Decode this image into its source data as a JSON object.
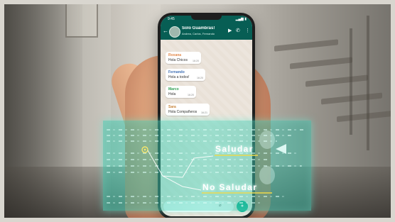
{
  "phone": {
    "status_time": "9:45",
    "chat_title": "Solo Guambras!",
    "chat_members": "Andrea, Carlos, Fernando",
    "messages": [
      {
        "sender": "Roxana",
        "text": "Hola Chicos",
        "time": "16:20"
      },
      {
        "sender": "Fernando",
        "text": "Hola a todos!",
        "time": "16:20"
      },
      {
        "sender": "Marco",
        "text": "Hola",
        "time": "16:20"
      },
      {
        "sender": "Sara",
        "text": "Hola Compañeros",
        "time": "16:21"
      }
    ]
  },
  "overlay": {
    "label_greet": "Saludar",
    "label_no_greet": "No Saludar"
  },
  "colors": {
    "whatsapp_header": "#075e54",
    "chat_background": "#ece5dd",
    "hologram": "#3fcfb0",
    "underline": "#f0d94a"
  },
  "icons": [
    "back-arrow-icon",
    "video-call-icon",
    "phone-call-icon",
    "menu-icon",
    "attach-icon",
    "mic-icon",
    "target-node-icon",
    "arrow-marker-icon"
  ]
}
